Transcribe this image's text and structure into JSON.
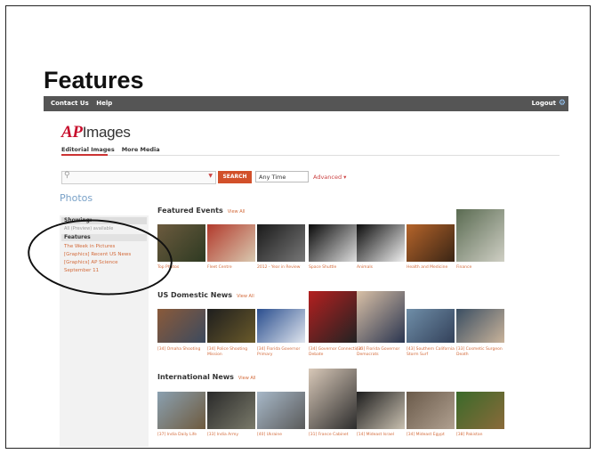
{
  "slide": {
    "title": "Features"
  },
  "topbar": {
    "contact": "Contact Us",
    "help": "Help",
    "logout": "Logout"
  },
  "logo": {
    "ap": "AP",
    "images": "Images"
  },
  "nav": {
    "tab1": "Editorial Images",
    "tab2": "More Media"
  },
  "search": {
    "placeholder": "",
    "button": "SEARCH",
    "time": "Any Time",
    "advanced": "Advanced"
  },
  "photos_heading": "Photos",
  "sidebar": {
    "showing": "Showing:    ",
    "sub": "All (Preview) available",
    "features": "Features",
    "links": [
      "The Week in Pictures",
      "[Graphics] Recent US News",
      "[Graphics] AP Science",
      "September 11"
    ]
  },
  "sections": [
    {
      "title": "Featured Events",
      "view_all": "View All",
      "items": [
        {
          "caption": "Top Photos",
          "colors": [
            "#6b5a3e",
            "#2e3a22"
          ]
        },
        {
          "caption": "Fleet Centre",
          "colors": [
            "#b23a2c",
            "#d9c9b0"
          ]
        },
        {
          "caption": "2012 - Year in Review",
          "colors": [
            "#1a1a1a",
            "#777777"
          ]
        },
        {
          "caption": "Space Shuttle",
          "colors": [
            "#0a0a0a",
            "#dddddd"
          ]
        },
        {
          "caption": "Animals",
          "colors": [
            "#0c0c0c",
            "#f0f0f0"
          ]
        },
        {
          "caption": "Health and Medicine",
          "colors": [
            "#b5642a",
            "#3a2515"
          ]
        },
        {
          "caption": "Finance",
          "colors": [
            "#5a6b52",
            "#cfcfc4"
          ]
        }
      ]
    },
    {
      "title": "US Domestic News",
      "view_all": "View All",
      "items": [
        {
          "caption": "[34] Omaha Shooting",
          "colors": [
            "#8a5a3a",
            "#3c4a5e"
          ]
        },
        {
          "caption": "[34] Police Shooting Mission",
          "colors": [
            "#1e1e1e",
            "#6a5a2a"
          ]
        },
        {
          "caption": "[34] Florida Governor Primary",
          "colors": [
            "#2a4e8e",
            "#dfe5ee"
          ]
        },
        {
          "caption": "[34] Governor Connecticut Debate",
          "colors": [
            "#b42020",
            "#222222"
          ]
        },
        {
          "caption": "[33] Florida Governor Democrats",
          "colors": [
            "#d9c0a6",
            "#2a3550"
          ]
        },
        {
          "caption": "[43] Southern California Storm Surf",
          "colors": [
            "#6f8ea8",
            "#33415a"
          ]
        },
        {
          "caption": "[33] Cosmetic Surgeon Death",
          "colors": [
            "#3a4e62",
            "#c9b39a"
          ]
        }
      ]
    },
    {
      "title": "International News",
      "view_all": "View All",
      "items": [
        {
          "caption": "[37] India Daily Life",
          "colors": [
            "#8aa0b0",
            "#6e5a3e"
          ]
        },
        {
          "caption": "[33] India Army",
          "colors": [
            "#2a2a2a",
            "#7a7a6a"
          ]
        },
        {
          "caption": "[40] Ukraine",
          "colors": [
            "#a7b8c8",
            "#5a5a5a"
          ]
        },
        {
          "caption": "[31] France Cabinet",
          "colors": [
            "#d8c8b8",
            "#2c2c2c"
          ]
        },
        {
          "caption": "[14] Mideast Israel",
          "colors": [
            "#1e1e1e",
            "#c9c0b0"
          ]
        },
        {
          "caption": "[34] Mideast Egypt",
          "colors": [
            "#6a5a4a",
            "#b0a090"
          ]
        },
        {
          "caption": "[38] Pakistan",
          "colors": [
            "#3a6a2a",
            "#8a6a3a"
          ]
        }
      ]
    }
  ]
}
